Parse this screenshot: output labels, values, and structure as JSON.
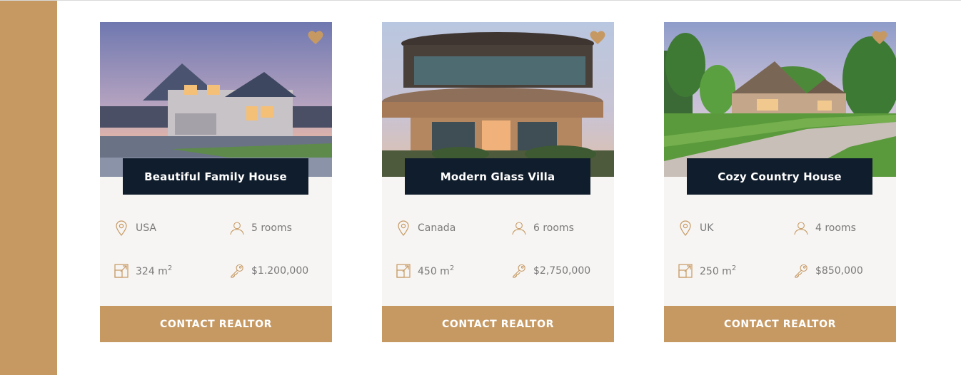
{
  "theme": {
    "accent": "#c69963",
    "dark": "#101d2c",
    "card_bg": "#f7f5f3",
    "text_muted": "#7a7a7a"
  },
  "icons": [
    "heart-icon",
    "map-pin-icon",
    "user-icon",
    "area-icon",
    "key-icon"
  ],
  "houses": [
    {
      "name": "Beautiful Family House",
      "location": "USA",
      "rooms": "5 rooms",
      "area": "324 m",
      "area_unit_sup": "2",
      "price": "$1.200,000",
      "cta": "CONTACT REALTOR"
    },
    {
      "name": "Modern Glass Villa",
      "location": "Canada",
      "rooms": "6 rooms",
      "area": "450 m",
      "area_unit_sup": "2",
      "price": "$2,750,000",
      "cta": "CONTACT REALTOR"
    },
    {
      "name": "Cozy Country House",
      "location": "UK",
      "rooms": "4 rooms",
      "area": "250 m",
      "area_unit_sup": "2",
      "price": "$850,000",
      "cta": "CONTACT REALTOR"
    }
  ]
}
